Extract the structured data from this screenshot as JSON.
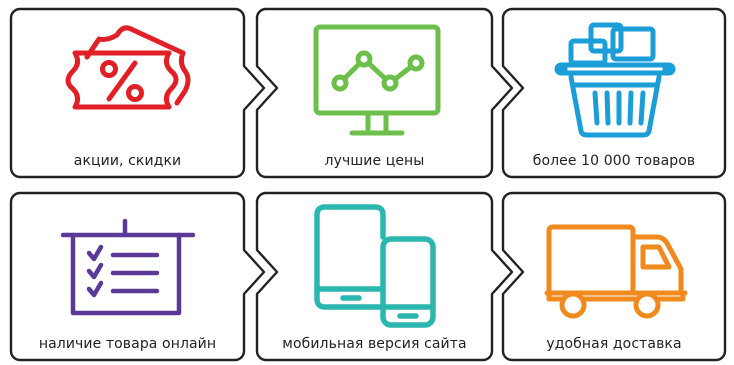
{
  "features": [
    {
      "label": "акции, скидки",
      "icon": "discount-tags-icon",
      "color": "#e11f26"
    },
    {
      "label": "лучшие цены",
      "icon": "price-chart-monitor-icon",
      "color": "#6cbf4a"
    },
    {
      "label": "более 10 000 товаров",
      "icon": "shopping-basket-icon",
      "color": "#1b9ed8"
    },
    {
      "label": "наличие товара онлайн",
      "icon": "checklist-board-icon",
      "color": "#5b3a97"
    },
    {
      "label": "мобильная версия сайта",
      "icon": "tablet-phone-icon",
      "color": "#2bb7b0"
    },
    {
      "label": "удобная доставка",
      "icon": "delivery-truck-icon",
      "color": "#f08a1e"
    }
  ],
  "border_color": "#222222"
}
